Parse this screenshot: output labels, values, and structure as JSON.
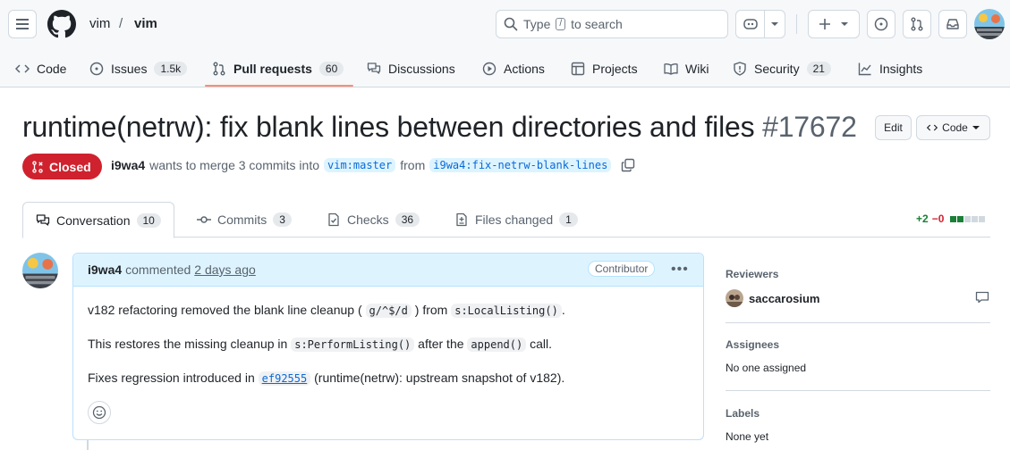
{
  "header": {
    "owner": "vim",
    "separator": "/",
    "repo": "vim",
    "search_prefix": "Type",
    "search_key": "/",
    "search_suffix": "to search"
  },
  "repo_nav": [
    {
      "label": "Code",
      "icon": "code-icon"
    },
    {
      "label": "Issues",
      "count": "1.5k",
      "icon": "issue-icon"
    },
    {
      "label": "Pull requests",
      "count": "60",
      "icon": "pull-request-icon",
      "active": true
    },
    {
      "label": "Discussions",
      "icon": "discussion-icon"
    },
    {
      "label": "Actions",
      "icon": "play-icon"
    },
    {
      "label": "Projects",
      "icon": "table-icon"
    },
    {
      "label": "Wiki",
      "icon": "book-icon"
    },
    {
      "label": "Security",
      "count": "21",
      "icon": "shield-icon"
    },
    {
      "label": "Insights",
      "icon": "graph-icon"
    }
  ],
  "pr": {
    "title": "runtime(netrw): fix blank lines between directories and files",
    "number": "#17672",
    "edit_label": "Edit",
    "code_label": "Code",
    "state": "Closed",
    "author": "i9wa4",
    "merge_text_1": "wants to merge 3 commits into",
    "base_branch": "vim:master",
    "merge_text_2": "from",
    "head_branch": "i9wa4:fix-netrw-blank-lines"
  },
  "tabs": [
    {
      "label": "Conversation",
      "count": "10"
    },
    {
      "label": "Commits",
      "count": "3"
    },
    {
      "label": "Checks",
      "count": "36"
    },
    {
      "label": "Files changed",
      "count": "1"
    }
  ],
  "diffstat": {
    "additions": "+2",
    "deletions": "−0"
  },
  "comment": {
    "author": "i9wa4",
    "action": "commented",
    "time": "2 days ago",
    "badge": "Contributor",
    "p1_a": "v182 refactoring removed the blank line cleanup (",
    "p1_code1": "g/^$/d",
    "p1_b": ") from",
    "p1_code2": "s:LocalListing()",
    "p1_c": ".",
    "p2_a": "This restores the missing cleanup in",
    "p2_code1": "s:PerformListing()",
    "p2_b": "after the",
    "p2_code2": "append()",
    "p2_c": "call.",
    "p3_a": "Fixes regression introduced in",
    "p3_link": "ef92555",
    "p3_b": "(runtime(netrw): upstream snapshot of v182)."
  },
  "sidebar": {
    "reviewers_label": "Reviewers",
    "reviewer": "saccarosium",
    "assignees_label": "Assignees",
    "assignees_value": "No one assigned",
    "labels_label": "Labels",
    "labels_value": "None yet"
  },
  "colors": {
    "accent": "#0969da",
    "closed": "#cf222e",
    "addition": "#1a7f37",
    "deletion": "#d1242f",
    "nav_underline": "#fd8c73"
  }
}
